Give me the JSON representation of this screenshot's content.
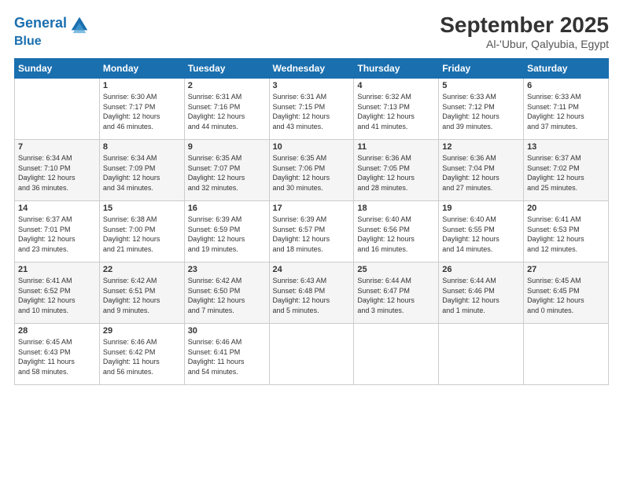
{
  "header": {
    "logo_line1": "General",
    "logo_line2": "Blue",
    "month": "September 2025",
    "location": "Al-'Ubur, Qalyubia, Egypt"
  },
  "days_of_week": [
    "Sunday",
    "Monday",
    "Tuesday",
    "Wednesday",
    "Thursday",
    "Friday",
    "Saturday"
  ],
  "weeks": [
    [
      {
        "day": "",
        "info": ""
      },
      {
        "day": "1",
        "info": "Sunrise: 6:30 AM\nSunset: 7:17 PM\nDaylight: 12 hours\nand 46 minutes."
      },
      {
        "day": "2",
        "info": "Sunrise: 6:31 AM\nSunset: 7:16 PM\nDaylight: 12 hours\nand 44 minutes."
      },
      {
        "day": "3",
        "info": "Sunrise: 6:31 AM\nSunset: 7:15 PM\nDaylight: 12 hours\nand 43 minutes."
      },
      {
        "day": "4",
        "info": "Sunrise: 6:32 AM\nSunset: 7:13 PM\nDaylight: 12 hours\nand 41 minutes."
      },
      {
        "day": "5",
        "info": "Sunrise: 6:33 AM\nSunset: 7:12 PM\nDaylight: 12 hours\nand 39 minutes."
      },
      {
        "day": "6",
        "info": "Sunrise: 6:33 AM\nSunset: 7:11 PM\nDaylight: 12 hours\nand 37 minutes."
      }
    ],
    [
      {
        "day": "7",
        "info": "Sunrise: 6:34 AM\nSunset: 7:10 PM\nDaylight: 12 hours\nand 36 minutes."
      },
      {
        "day": "8",
        "info": "Sunrise: 6:34 AM\nSunset: 7:09 PM\nDaylight: 12 hours\nand 34 minutes."
      },
      {
        "day": "9",
        "info": "Sunrise: 6:35 AM\nSunset: 7:07 PM\nDaylight: 12 hours\nand 32 minutes."
      },
      {
        "day": "10",
        "info": "Sunrise: 6:35 AM\nSunset: 7:06 PM\nDaylight: 12 hours\nand 30 minutes."
      },
      {
        "day": "11",
        "info": "Sunrise: 6:36 AM\nSunset: 7:05 PM\nDaylight: 12 hours\nand 28 minutes."
      },
      {
        "day": "12",
        "info": "Sunrise: 6:36 AM\nSunset: 7:04 PM\nDaylight: 12 hours\nand 27 minutes."
      },
      {
        "day": "13",
        "info": "Sunrise: 6:37 AM\nSunset: 7:02 PM\nDaylight: 12 hours\nand 25 minutes."
      }
    ],
    [
      {
        "day": "14",
        "info": "Sunrise: 6:37 AM\nSunset: 7:01 PM\nDaylight: 12 hours\nand 23 minutes."
      },
      {
        "day": "15",
        "info": "Sunrise: 6:38 AM\nSunset: 7:00 PM\nDaylight: 12 hours\nand 21 minutes."
      },
      {
        "day": "16",
        "info": "Sunrise: 6:39 AM\nSunset: 6:59 PM\nDaylight: 12 hours\nand 19 minutes."
      },
      {
        "day": "17",
        "info": "Sunrise: 6:39 AM\nSunset: 6:57 PM\nDaylight: 12 hours\nand 18 minutes."
      },
      {
        "day": "18",
        "info": "Sunrise: 6:40 AM\nSunset: 6:56 PM\nDaylight: 12 hours\nand 16 minutes."
      },
      {
        "day": "19",
        "info": "Sunrise: 6:40 AM\nSunset: 6:55 PM\nDaylight: 12 hours\nand 14 minutes."
      },
      {
        "day": "20",
        "info": "Sunrise: 6:41 AM\nSunset: 6:53 PM\nDaylight: 12 hours\nand 12 minutes."
      }
    ],
    [
      {
        "day": "21",
        "info": "Sunrise: 6:41 AM\nSunset: 6:52 PM\nDaylight: 12 hours\nand 10 minutes."
      },
      {
        "day": "22",
        "info": "Sunrise: 6:42 AM\nSunset: 6:51 PM\nDaylight: 12 hours\nand 9 minutes."
      },
      {
        "day": "23",
        "info": "Sunrise: 6:42 AM\nSunset: 6:50 PM\nDaylight: 12 hours\nand 7 minutes."
      },
      {
        "day": "24",
        "info": "Sunrise: 6:43 AM\nSunset: 6:48 PM\nDaylight: 12 hours\nand 5 minutes."
      },
      {
        "day": "25",
        "info": "Sunrise: 6:44 AM\nSunset: 6:47 PM\nDaylight: 12 hours\nand 3 minutes."
      },
      {
        "day": "26",
        "info": "Sunrise: 6:44 AM\nSunset: 6:46 PM\nDaylight: 12 hours\nand 1 minute."
      },
      {
        "day": "27",
        "info": "Sunrise: 6:45 AM\nSunset: 6:45 PM\nDaylight: 12 hours\nand 0 minutes."
      }
    ],
    [
      {
        "day": "28",
        "info": "Sunrise: 6:45 AM\nSunset: 6:43 PM\nDaylight: 11 hours\nand 58 minutes."
      },
      {
        "day": "29",
        "info": "Sunrise: 6:46 AM\nSunset: 6:42 PM\nDaylight: 11 hours\nand 56 minutes."
      },
      {
        "day": "30",
        "info": "Sunrise: 6:46 AM\nSunset: 6:41 PM\nDaylight: 11 hours\nand 54 minutes."
      },
      {
        "day": "",
        "info": ""
      },
      {
        "day": "",
        "info": ""
      },
      {
        "day": "",
        "info": ""
      },
      {
        "day": "",
        "info": ""
      }
    ]
  ]
}
